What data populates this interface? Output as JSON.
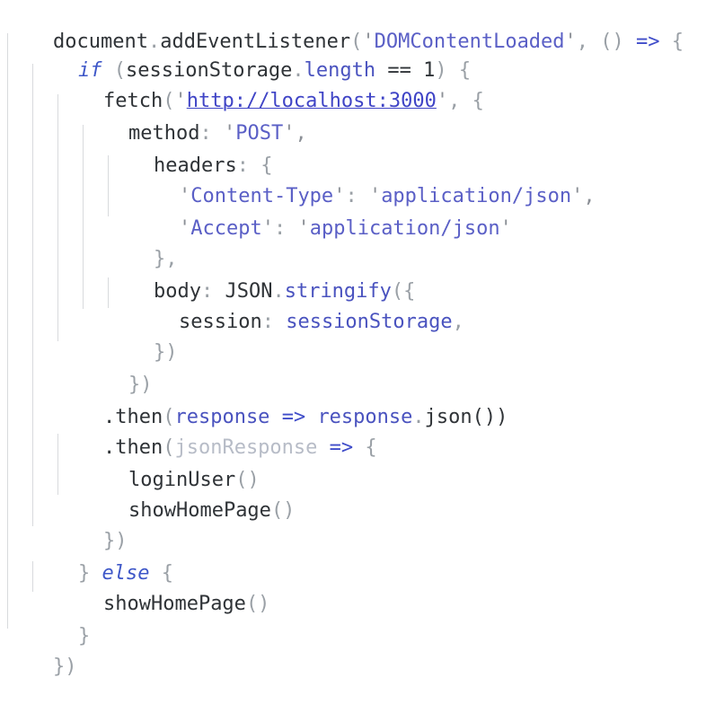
{
  "code": {
    "l1": {
      "t1": "document",
      "t2": ".",
      "t3": "addEventListener",
      "t4": "(",
      "t5": "'",
      "t6": "DOMContentLoaded",
      "t7": "'",
      "t8": ", () ",
      "t9": "=>",
      "t10": " {"
    },
    "l2": {
      "t1": "if",
      "t2": " (",
      "t3": "sessionStorage",
      "t4": ".",
      "t5": "length",
      "t6": " ",
      "t7": "==",
      "t8": " ",
      "t9": "1",
      "t10": ") {"
    },
    "l3": {
      "t1": "fetch",
      "t2": "(",
      "t3": "'",
      "t4": "http://localhost:3000",
      "t5": "'",
      "t6": ", {"
    },
    "l4": {
      "t1": "method",
      "t2": ": ",
      "t3": "'",
      "t4": "POST",
      "t5": "',"
    },
    "l5": {
      "t1": "headers",
      "t2": ": {"
    },
    "l6": {
      "t1": "'",
      "t2": "Content-Type",
      "t3": "'",
      "t4": ": ",
      "t5": "'",
      "t6": "application/json",
      "t7": "',"
    },
    "l7": {
      "t1": "'",
      "t2": "Accept",
      "t3": "'",
      "t4": ": ",
      "t5": "'",
      "t6": "application/json",
      "t7": "'"
    },
    "l8": {
      "t1": "},"
    },
    "l9": {
      "t1": "body",
      "t2": ": ",
      "t3": "JSON",
      "t4": ".",
      "t5": "stringify",
      "t6": "({"
    },
    "l10": {
      "t1": "session",
      "t2": ": ",
      "t3": "sessionStorage",
      "t4": ","
    },
    "l11": {
      "t1": "})"
    },
    "l12": {
      "t1": "})"
    },
    "l13": {
      "t1": ".then",
      "t2": "(",
      "t3": "response",
      "t4": " ",
      "t5": "=>",
      "t6": " ",
      "t7": "response",
      "t8": ".",
      "t9": "json",
      "t10": "())"
    },
    "l14": {
      "t1": ".then",
      "t2": "(",
      "t3": "jsonResponse",
      "t4": " ",
      "t5": "=>",
      "t6": " {"
    },
    "l15": {
      "t1": "loginUser",
      "t2": "()"
    },
    "l16": {
      "t1": "showHomePage",
      "t2": "()"
    },
    "l17": {
      "t1": "})"
    },
    "l18": {
      "t1": "} ",
      "t2": "else",
      "t3": " {"
    },
    "l19": {
      "t1": "showHomePage",
      "t2": "()"
    },
    "l20": {
      "t1": "}"
    },
    "l21": {
      "t1": "})"
    }
  }
}
